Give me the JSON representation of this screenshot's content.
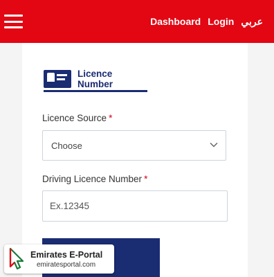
{
  "header": {
    "nav": {
      "dashboard": "Dashboard",
      "login": "Login",
      "arabic": "عربي"
    },
    "brand_color": "#e30613"
  },
  "form": {
    "tab": {
      "label": "Licence Number",
      "icon": "licence-card-icon"
    },
    "licence_source": {
      "label": "Licence Source",
      "required_mark": "*",
      "selected": "Choose",
      "icon": "chevron-down-icon"
    },
    "licence_number": {
      "label": "Driving Licence Number",
      "required_mark": "*",
      "placeholder": "Ex.12345",
      "value": ""
    },
    "accent_color": "#1a2c72"
  },
  "watermark": {
    "title": "Emirates E-Portal",
    "url": "emiratesportal.com",
    "icon": "cursor-logo-icon"
  }
}
